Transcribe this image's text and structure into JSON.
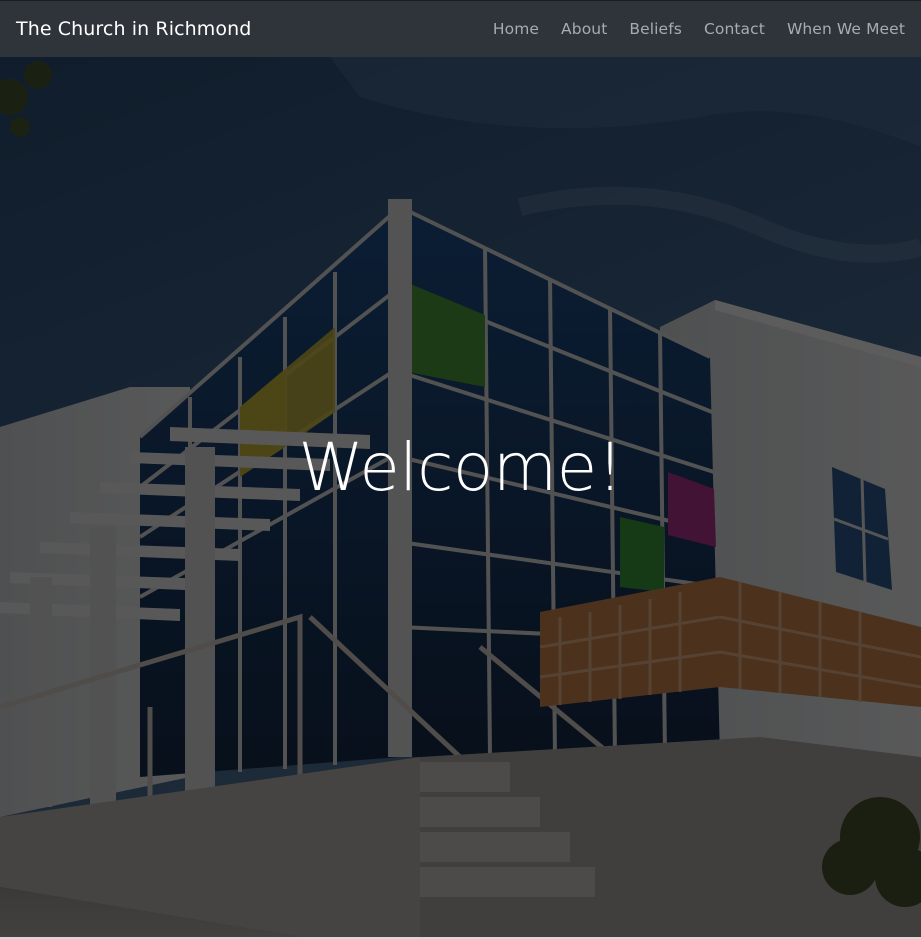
{
  "navbar": {
    "brand": "The Church in Richmond",
    "links": [
      {
        "label": "Home"
      },
      {
        "label": "About"
      },
      {
        "label": "Beliefs"
      },
      {
        "label": "Contact"
      },
      {
        "label": "When We Meet"
      }
    ]
  },
  "hero": {
    "title": "Welcome!"
  },
  "colors": {
    "navbar_bg": "#2f333a",
    "brand_text": "#ffffff",
    "nav_link_text": "#a8abb0",
    "hero_overlay": "#000000"
  }
}
